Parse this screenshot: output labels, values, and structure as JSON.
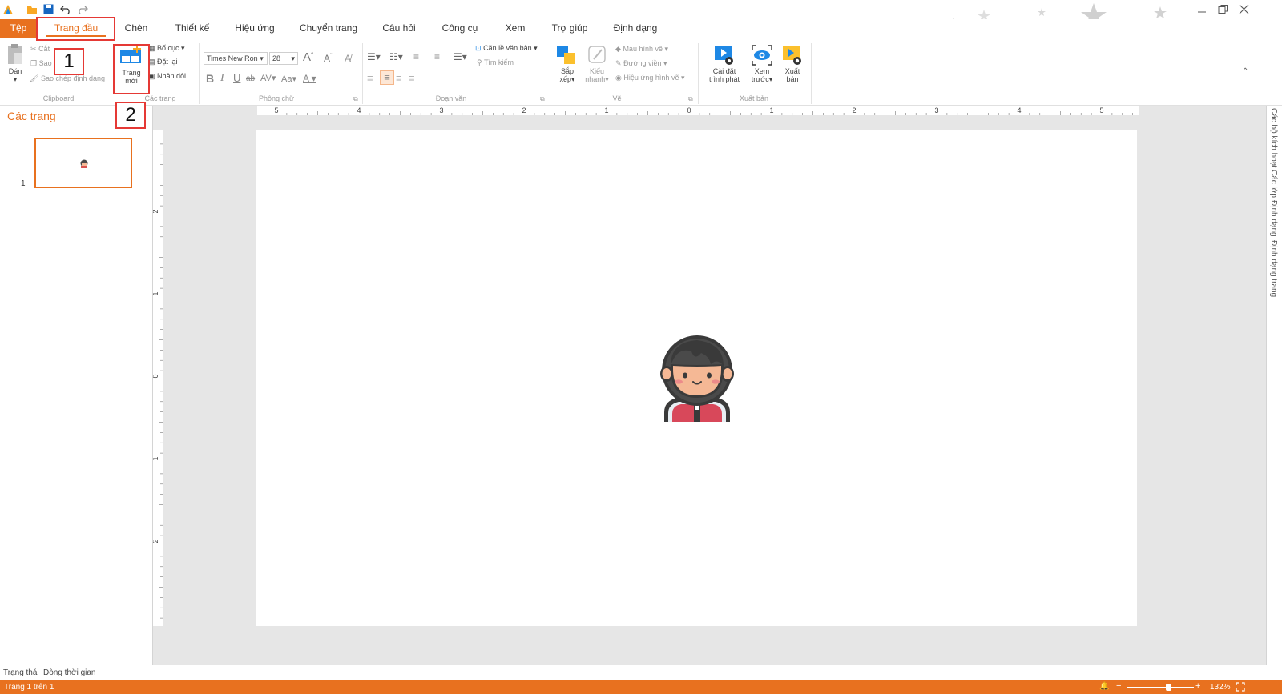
{
  "tabs": [
    {
      "label": "Tệp"
    },
    {
      "label": "Trang đầu"
    },
    {
      "label": "Chèn"
    },
    {
      "label": "Thiết kế"
    },
    {
      "label": "Hiệu ứng"
    },
    {
      "label": "Chuyển trang"
    },
    {
      "label": "Câu hỏi"
    },
    {
      "label": "Công cụ"
    },
    {
      "label": "Xem"
    },
    {
      "label": "Trợ giúp"
    },
    {
      "label": "Định dạng"
    }
  ],
  "ribbon": {
    "clipboard": {
      "paste": "Dán",
      "cut": "Cắt",
      "copy": "Sao",
      "format_painter": "Sao chép định dạng",
      "label": "Clipboard"
    },
    "pages": {
      "new_page_line1": "Trang",
      "new_page_line2": "mới",
      "layout": "Bố cục",
      "reset": "Đặt lại",
      "duplicate": "Nhân đôi",
      "label": "Các trang"
    },
    "font": {
      "family": "Times New Ron",
      "size": "28",
      "label": "Phông chữ"
    },
    "paragraph": {
      "align_text": "Căn lề văn bản",
      "find": "Tìm kiếm",
      "label": "Đoạn văn"
    },
    "drawing": {
      "arrange_line1": "Sắp",
      "arrange_line2": "xếp",
      "quick_styles_line1": "Kiểu",
      "quick_styles_line2": "nhanh",
      "shape_fill": "Màu hình vẽ",
      "outline": "Đường viền",
      "effects": "Hiệu ứng hình vẽ",
      "label": "Vẽ"
    },
    "publish": {
      "player_line1": "Cài đặt",
      "player_line2": "trình phát",
      "preview_line1": "Xem",
      "preview_line2": "trước",
      "publish_line1": "Xuất",
      "publish_line2": "bản",
      "label": "Xuất bản"
    }
  },
  "left_panel": {
    "title": "Các trang",
    "slide_number": "1"
  },
  "rulers": {
    "horizontal": [
      "5",
      "4",
      "3",
      "2",
      "1",
      "0",
      "1",
      "2",
      "3",
      "4",
      "5"
    ],
    "vertical": [
      "2",
      "1",
      "0",
      "1",
      "2"
    ]
  },
  "right_panel": {
    "triggers": "Các bộ kích hoạt",
    "layers": "Các lớp",
    "format": "Định dạng",
    "page_format": "Định dạng trang"
  },
  "status_tabs": {
    "states": "Trạng thái",
    "timeline": "Dòng thời gian"
  },
  "status_bar": {
    "page_info": "Trang 1 trên 1",
    "zoom_minus": "−",
    "zoom_plus": "+",
    "zoom_level": "132%",
    "zoom_fraction": 0.62
  },
  "annotations": {
    "step1": "1",
    "step2": "2"
  },
  "colors": {
    "accent": "#e8711f",
    "highlight": "#e53935"
  }
}
